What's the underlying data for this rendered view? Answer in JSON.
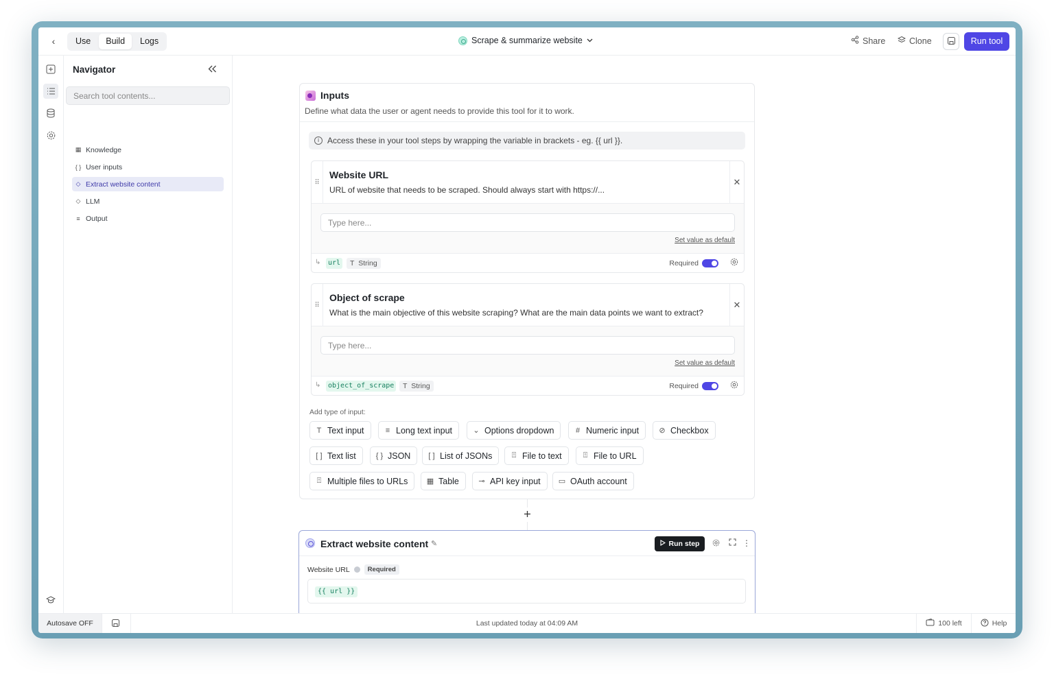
{
  "topbar": {
    "tabs": [
      {
        "label": "Use"
      },
      {
        "label": "Build"
      },
      {
        "label": "Logs"
      }
    ],
    "active_tab": "Build",
    "tool_title": "Scrape & summarize website",
    "share_label": "Share",
    "clone_label": "Clone",
    "run_tool_label": "Run tool"
  },
  "navigator": {
    "title": "Navigator",
    "search_placeholder": "Search tool contents...",
    "items": [
      {
        "label": "Knowledge",
        "icon": "table-icon"
      },
      {
        "label": "User inputs",
        "icon": "brackets-icon"
      },
      {
        "label": "Extract website content",
        "icon": "diamond-icon"
      },
      {
        "label": "LLM",
        "icon": "diamond-icon"
      },
      {
        "label": "Output",
        "icon": "output-icon"
      }
    ],
    "active_item": "Extract website content"
  },
  "inputs": {
    "title": "Inputs",
    "subtitle": "Define what data the user or agent needs to provide this tool for it to work.",
    "info_text": "Access these in your tool steps by wrapping the variable in brackets - eg. {{ url }}.",
    "fields": [
      {
        "name": "Website URL",
        "description": "URL of website that needs to be scraped. Should always start with https://...",
        "placeholder": "Type here...",
        "set_default_label": "Set value as default",
        "variable": "url",
        "type": "String",
        "required_label": "Required",
        "required": true
      },
      {
        "name": "Object of scrape",
        "description": "What is the main objective of this website scraping? What are the main data points we want to extract?",
        "placeholder": "Type here...",
        "set_default_label": "Set value as default",
        "variable": "object_of_scrape",
        "type": "String",
        "required_label": "Required",
        "required": true
      }
    ],
    "add_type_label": "Add type of input:",
    "input_types": [
      {
        "label": "Text input",
        "icon": "T"
      },
      {
        "label": "Long text input",
        "icon": "≡"
      },
      {
        "label": "Options dropdown",
        "icon": "⌄"
      },
      {
        "label": "Numeric input",
        "icon": "#"
      },
      {
        "label": "Checkbox",
        "icon": "✓"
      },
      {
        "label": "Text list",
        "icon": "[ ]"
      },
      {
        "label": "JSON",
        "icon": "{ }"
      },
      {
        "label": "List of JSONs",
        "icon": "[ ]"
      },
      {
        "label": "File to text",
        "icon": "⍐"
      },
      {
        "label": "File to URL",
        "icon": "⍐"
      },
      {
        "label": "Multiple files to URLs",
        "icon": "⍐"
      },
      {
        "label": "Table",
        "icon": "▦"
      },
      {
        "label": "API key input",
        "icon": "⊸"
      },
      {
        "label": "OAuth account",
        "icon": "▭"
      }
    ]
  },
  "step": {
    "title": "Extract website content",
    "run_step_label": "Run step",
    "field_label": "Website URL",
    "required_badge": "Required",
    "value": "{{ url }}"
  },
  "footer": {
    "autosave": "Autosave OFF",
    "last_updated": "Last updated today at 04:09 AM",
    "credits": "100 left",
    "help": "Help"
  },
  "colors": {
    "accent": "#4f46e5",
    "variable_bg": "#e3f7ee",
    "variable_text": "#17805f"
  }
}
